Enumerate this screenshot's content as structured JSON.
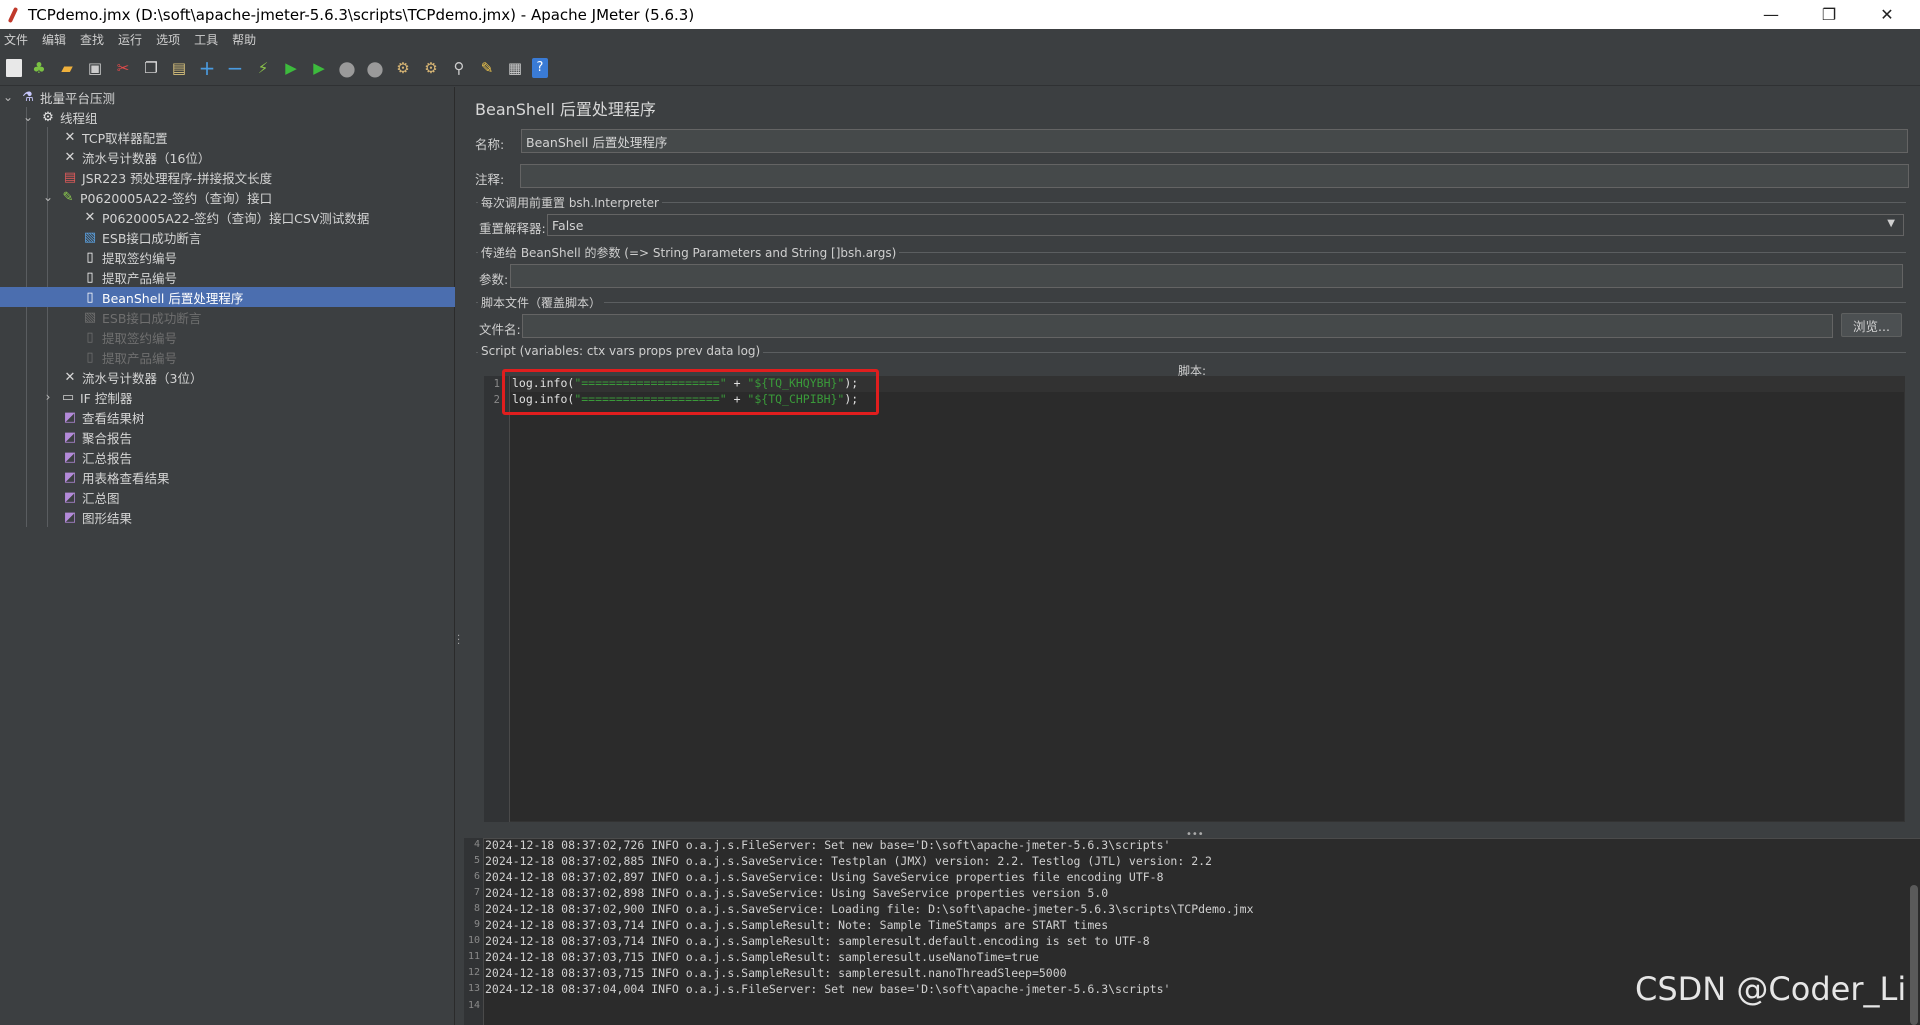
{
  "window": {
    "title": "TCPdemo.jmx (D:\\soft\\apache-jmeter-5.6.3\\scripts\\TCPdemo.jmx) - Apache JMeter (5.6.3)",
    "minimize": "—",
    "maximize": "❐",
    "close": "✕"
  },
  "menu": [
    "文件",
    "编辑",
    "查找",
    "运行",
    "选项",
    "工具",
    "帮助"
  ],
  "tree": {
    "nodes": [
      {
        "label": "批量平台压测",
        "icon": "flask-icon"
      },
      {
        "label": "线程组",
        "icon": "gear-icon"
      },
      {
        "label": "TCP取样器配置",
        "icon": "wrench-icon"
      },
      {
        "label": "流水号计数器（16位）",
        "icon": "wrench-icon"
      },
      {
        "label": "JSR223 预处理程序-拼接报文长度",
        "icon": "script-icon"
      },
      {
        "label": "P0620005A22-签约（查询）接口",
        "icon": "pipette-icon"
      },
      {
        "label": "P0620005A22-签约（查询）接口CSV测试数据",
        "icon": "wrench-icon"
      },
      {
        "label": "ESB接口成功断言",
        "icon": "assert-icon"
      },
      {
        "label": "提取签约编号",
        "icon": "doc-icon"
      },
      {
        "label": "提取产品编号",
        "icon": "doc-icon"
      },
      {
        "label": "BeanShell 后置处理程序",
        "icon": "doc-icon"
      },
      {
        "label": "ESB接口成功断言",
        "icon": "assert-icon"
      },
      {
        "label": "提取签约编号",
        "icon": "doc-icon"
      },
      {
        "label": "提取产品编号",
        "icon": "doc-icon"
      },
      {
        "label": "流水号计数器（3位）",
        "icon": "wrench-icon"
      },
      {
        "label": "IF 控制器",
        "icon": "folder-icon"
      },
      {
        "label": "查看结果树",
        "icon": "chart-icon"
      },
      {
        "label": "聚合报告",
        "icon": "chart-icon"
      },
      {
        "label": "汇总报告",
        "icon": "chart-icon"
      },
      {
        "label": "用表格查看结果",
        "icon": "chart-icon"
      },
      {
        "label": "汇总图",
        "icon": "chart-icon"
      },
      {
        "label": "图形结果",
        "icon": "chart-icon"
      }
    ]
  },
  "panel": {
    "title": "BeanShell 后置处理程序",
    "name_label": "名称:",
    "name_value": "BeanShell 后置处理程序",
    "comment_label": "注释:",
    "comment_value": "",
    "reset_group": "每次调用前重置 bsh.Interpreter",
    "reset_label": "重置解释器:",
    "reset_value": "False",
    "params_group": "传递给 BeanShell 的参数 (=> String Parameters and String []bsh.args)",
    "params_label": "参数:",
    "params_value": "",
    "file_group": "脚本文件（覆盖脚本）",
    "file_label": "文件名:",
    "file_value": "",
    "browse": "浏览...",
    "script_group": "Script (variables: ctx vars props prev data log)",
    "script_header": "脚本:"
  },
  "script": {
    "line_numbers": [
      "1",
      "2"
    ],
    "line1_prefix": "log.info(",
    "line1_str1": "\"====================\"",
    "line1_mid": " + ",
    "line1_str2": "\"${TQ_KHQYBH}\"",
    "line1_suffix": ");",
    "line2_prefix": "log.info(",
    "line2_str1": "\"====================\"",
    "line2_mid": " + ",
    "line2_str2": "\"${TQ_CHPIBH}\"",
    "line2_suffix": ");"
  },
  "log": {
    "lines": [
      {
        "n": "4",
        "text": "2024-12-18 08:37:02,726 INFO o.a.j.s.FileServer: Set new base='D:\\soft\\apache-jmeter-5.6.3\\scripts'"
      },
      {
        "n": "5",
        "text": "2024-12-18 08:37:02,885 INFO o.a.j.s.SaveService: Testplan (JMX) version: 2.2. Testlog (JTL) version: 2.2"
      },
      {
        "n": "6",
        "text": "2024-12-18 08:37:02,897 INFO o.a.j.s.SaveService: Using SaveService properties file encoding UTF-8"
      },
      {
        "n": "7",
        "text": "2024-12-18 08:37:02,898 INFO o.a.j.s.SaveService: Using SaveService properties version 5.0"
      },
      {
        "n": "8",
        "text": "2024-12-18 08:37:02,900 INFO o.a.j.s.SaveService: Loading file: D:\\soft\\apache-jmeter-5.6.3\\scripts\\TCPdemo.jmx"
      },
      {
        "n": "9",
        "text": "2024-12-18 08:37:03,714 INFO o.a.j.s.SampleResult: Note: Sample TimeStamps are START times"
      },
      {
        "n": "10",
        "text": "2024-12-18 08:37:03,714 INFO o.a.j.s.SampleResult: sampleresult.default.encoding is set to UTF-8"
      },
      {
        "n": "11",
        "text": "2024-12-18 08:37:03,715 INFO o.a.j.s.SampleResult: sampleresult.useNanoTime=true"
      },
      {
        "n": "12",
        "text": "2024-12-18 08:37:03,715 INFO o.a.j.s.SampleResult: sampleresult.nanoThreadSleep=5000"
      },
      {
        "n": "13",
        "text": "2024-12-18 08:37:04,004 INFO o.a.j.s.FileServer: Set new base='D:\\soft\\apache-jmeter-5.6.3\\scripts'"
      },
      {
        "n": "14",
        "text": ""
      }
    ]
  },
  "watermark": "CSDN @Coder_Li"
}
